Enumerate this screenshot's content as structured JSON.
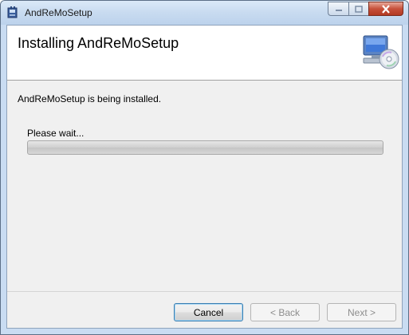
{
  "window": {
    "title": "AndReMoSetup"
  },
  "banner": {
    "heading": "Installing AndReMoSetup",
    "icon": "computer-cd-icon"
  },
  "main": {
    "status_text": "AndReMoSetup is being installed.",
    "wait_label": "Please wait...",
    "progress_percent": 0
  },
  "buttons": {
    "cancel_label": "Cancel",
    "back_label": "< Back",
    "next_label": "Next >"
  },
  "colors": {
    "titlebar": "#c8dbf0",
    "close_button": "#c7503a",
    "progress_fill": "#5ec45e"
  }
}
